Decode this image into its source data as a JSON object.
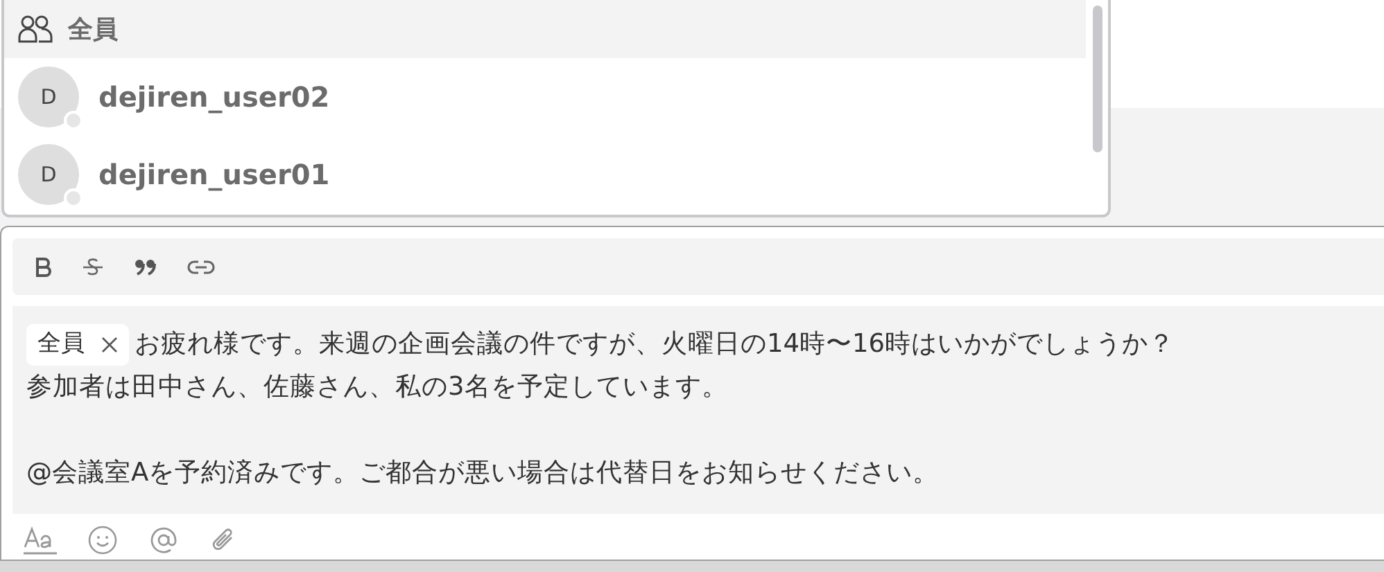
{
  "mention_popup": {
    "header": {
      "label": "全員",
      "selected": true
    },
    "items": [
      {
        "initial": "D",
        "name": "dejiren_user02",
        "online": false,
        "selected": false
      },
      {
        "initial": "D",
        "name": "dejiren_user01",
        "online": false,
        "selected": false
      }
    ]
  },
  "editor": {
    "toolbar": [
      {
        "kind": "bold"
      },
      {
        "kind": "strike"
      },
      {
        "kind": "quote"
      },
      {
        "kind": "link"
      }
    ],
    "mention_chip": "全員",
    "paragraphs": [
      [
        "お疲れ様です。来週の企画会議の件ですが、火曜日の14時〜16時はいかがでしょうか？",
        "参加者は田中さん、佐藤さん、私の3名を予定しています。"
      ],
      [
        "@会議室Aを予約済みです。ご都合が悪い場合は代替日をお知らせください。"
      ]
    ],
    "bottom_tools": [
      {
        "kind": "format"
      },
      {
        "kind": "emoji"
      },
      {
        "kind": "mention"
      },
      {
        "kind": "attach"
      }
    ]
  }
}
